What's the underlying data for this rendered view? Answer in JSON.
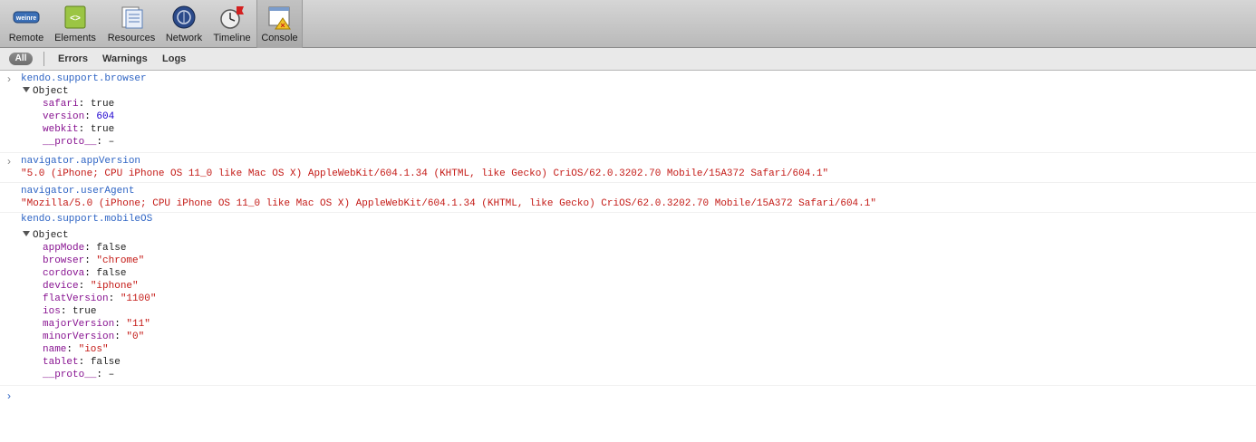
{
  "toolbar": {
    "items": [
      {
        "label": "Remote",
        "icon": "weinre-icon"
      },
      {
        "label": "Elements",
        "icon": "elements-icon"
      },
      {
        "label": "Resources",
        "icon": "resources-icon"
      },
      {
        "label": "Network",
        "icon": "network-icon"
      },
      {
        "label": "Timeline",
        "icon": "timeline-icon"
      },
      {
        "label": "Console",
        "icon": "console-icon"
      }
    ],
    "logo_text": "weinre"
  },
  "filters": {
    "all": "All",
    "errors": "Errors",
    "warnings": "Warnings",
    "logs": "Logs"
  },
  "console": {
    "cmd1": "kendo.support.browser",
    "obj1_head": "Object",
    "obj1": [
      {
        "key": "safari",
        "value": "true"
      },
      {
        "key": "version",
        "value": "604"
      },
      {
        "key": "webkit",
        "value": "true"
      },
      {
        "key": "__proto__",
        "value": "–"
      }
    ],
    "cmd2": "navigator.appVersion",
    "res2": "\"5.0 (iPhone; CPU iPhone OS 11_0 like Mac OS X) AppleWebKit/604.1.34 (KHTML, like Gecko) CriOS/62.0.3202.70 Mobile/15A372 Safari/604.1\"",
    "cmd3": "navigator.userAgent",
    "res3": "\"Mozilla/5.0 (iPhone; CPU iPhone OS 11_0 like Mac OS X) AppleWebKit/604.1.34 (KHTML, like Gecko) CriOS/62.0.3202.70 Mobile/15A372 Safari/604.1\"",
    "cmd4": "kendo.support.mobileOS",
    "obj4_head": "Object",
    "obj4": [
      {
        "key": "appMode",
        "value": "false"
      },
      {
        "key": "browser",
        "value": "\"chrome\""
      },
      {
        "key": "cordova",
        "value": "false"
      },
      {
        "key": "device",
        "value": "\"iphone\""
      },
      {
        "key": "flatVersion",
        "value": "\"1100\""
      },
      {
        "key": "ios",
        "value": "true"
      },
      {
        "key": "majorVersion",
        "value": "\"11\""
      },
      {
        "key": "minorVersion",
        "value": "\"0\""
      },
      {
        "key": "name",
        "value": "\"ios\""
      },
      {
        "key": "tablet",
        "value": "false"
      },
      {
        "key": "__proto__",
        "value": "–"
      }
    ],
    "prompt_glyph": "›"
  }
}
